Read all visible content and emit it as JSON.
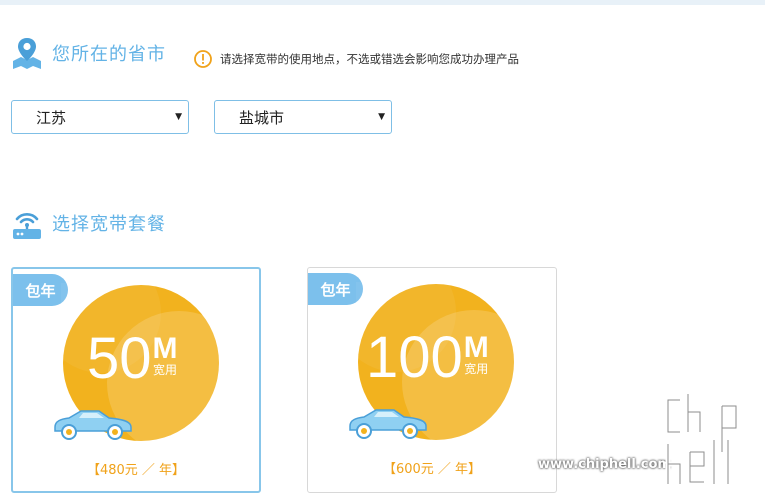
{
  "province_section": {
    "title": "您所在的省市",
    "notice": "请选择宽带的使用地点，不选或错选会影响您成功办理产品"
  },
  "selects": {
    "province": {
      "value": "江苏"
    },
    "city": {
      "value": "盐城市"
    }
  },
  "package_section": {
    "title": "选择宽带套餐"
  },
  "packages": [
    {
      "badge": "包年",
      "speed": "50",
      "unit": "M",
      "unit_sub": "宽用",
      "price": "【480元 ／ 年】"
    },
    {
      "badge": "包年",
      "speed": "100",
      "unit": "M",
      "unit_sub": "宽用",
      "price": "【600元 ／ 年】"
    }
  ],
  "watermark": {
    "text": "www.chiphell.com",
    "logo": "chip hell"
  },
  "colors": {
    "accent_blue": "#63b3e6",
    "badge_blue": "#7cc0ec",
    "circle_gold": "#f2b21e",
    "price_orange": "#f0a21a",
    "warn_orange": "#f0a21a"
  }
}
